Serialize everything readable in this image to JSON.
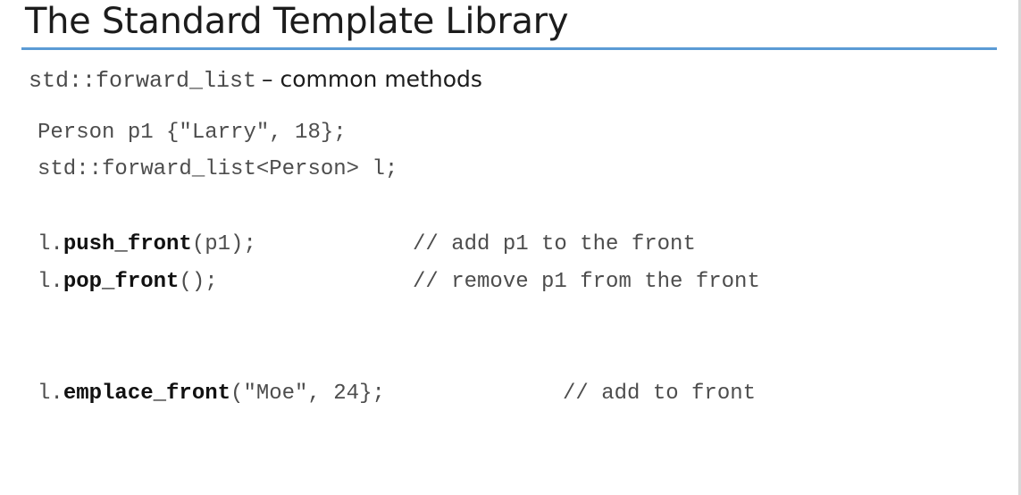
{
  "slide": {
    "title": "The Standard Template Library",
    "subtitle_code": "std::forward_list",
    "subtitle_text": "– common methods"
  },
  "code": {
    "line1": "Person p1 {\"Larry\", 18};",
    "line2": "std::forward_list<Person> l;",
    "line3": {
      "prefix": "l.",
      "method": "push_front",
      "suffix": "(p1);",
      "comment": "// add p1 to the front"
    },
    "line4": {
      "prefix": "l.",
      "method": "pop_front",
      "suffix": "();",
      "comment": "// remove p1 from the front"
    },
    "line5": {
      "prefix": "l.",
      "method": "emplace_front",
      "suffix": "(\"Moe\", 24};",
      "comment": "// add to front"
    }
  },
  "colors": {
    "accent_rule": "#5b9bd5",
    "code_text": "#4d4d4d",
    "keyword_text": "#111111"
  }
}
